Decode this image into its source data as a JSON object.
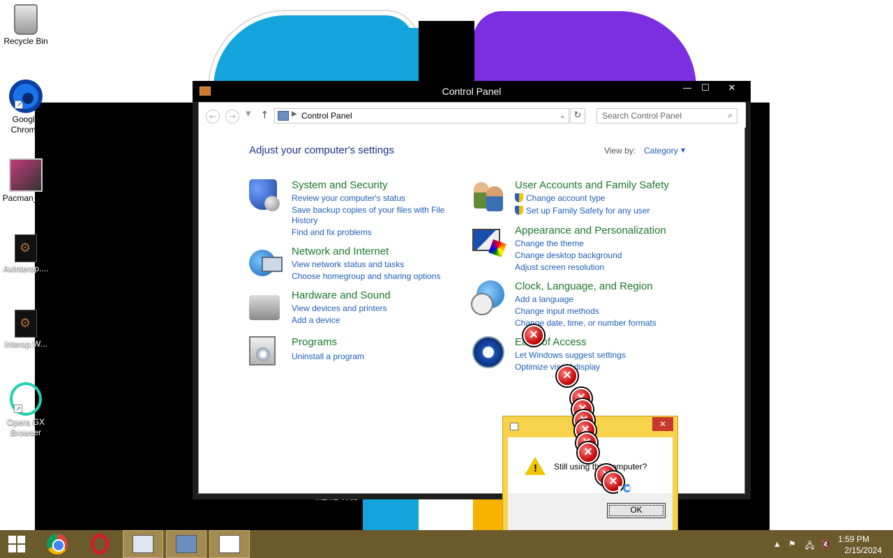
{
  "desktop": {
    "icons": [
      {
        "label": "Recycle Bin",
        "icon": "recycle-bin-icon"
      },
      {
        "label": "Google Chrome",
        "icon": "chrome-icon"
      },
      {
        "label": "Pacman_s...",
        "icon": "app-icon"
      },
      {
        "label": "AxInterop....",
        "icon": "file-icon"
      },
      {
        "label": "Interop.W...",
        "icon": "file-icon"
      },
      {
        "label": "Opera GX Browser",
        "icon": "opera-gx-icon"
      }
    ],
    "meme_text": "MEME Virus"
  },
  "control_panel": {
    "title": "Control Panel",
    "address": "Control Panel",
    "search_placeholder": "Search Control Panel",
    "heading": "Adjust your computer's settings",
    "view_by_label": "View by:",
    "view_by_value": "Category",
    "categories": [
      {
        "title": "System and Security",
        "links": [
          "Review your computer's status",
          "Save backup copies of your files with File",
          "History",
          "Find and fix problems"
        ]
      },
      {
        "title": "Network and Internet",
        "links": [
          "View network status and tasks",
          "Choose homegroup and sharing options"
        ]
      },
      {
        "title": "Hardware and Sound",
        "links": [
          "View devices and printers",
          "Add a device"
        ]
      },
      {
        "title": "Programs",
        "links": [
          "Uninstall a program"
        ]
      },
      {
        "title": "User Accounts and Family Safety",
        "links": [
          "Change account type",
          "Set up Family Safety for any user"
        ]
      },
      {
        "title": "Appearance and Personalization",
        "links": [
          "Change the theme",
          "Change desktop background",
          "Adjust screen resolution"
        ]
      },
      {
        "title": "Clock, Language, and Region",
        "links": [
          "Add a language",
          "Change input methods",
          "Change date, time, or number formats"
        ]
      },
      {
        "title": "Ease of Access",
        "links": [
          "Let Windows suggest settings",
          "Optimize visual display"
        ]
      }
    ]
  },
  "dialog": {
    "message": "Still using this computer?",
    "ok_label": "OK",
    "close_glyph": "✕"
  },
  "taskbar": {
    "time": "1:59 PM",
    "date": "2/15/2024"
  }
}
